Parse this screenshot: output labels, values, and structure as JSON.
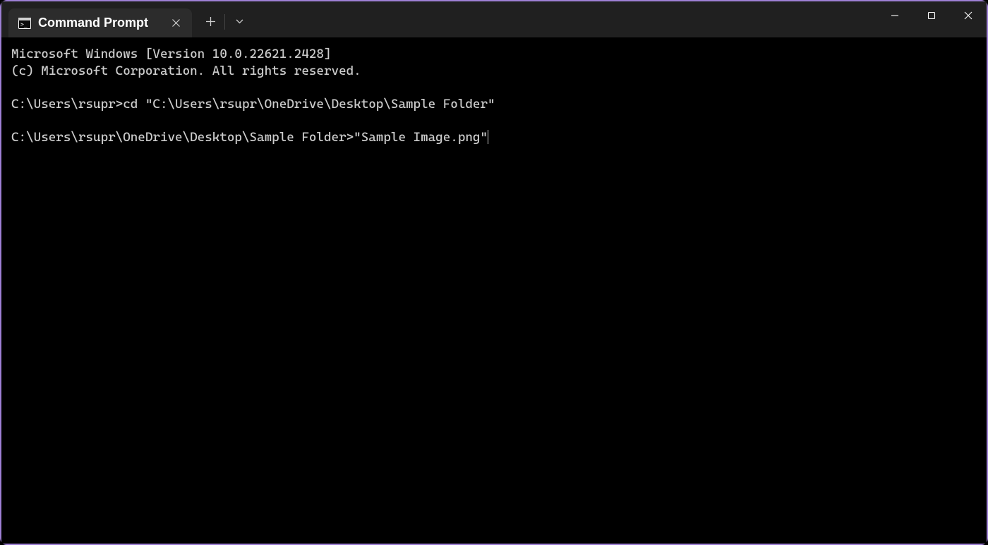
{
  "tab": {
    "title": "Command Prompt"
  },
  "terminal": {
    "line1": "Microsoft Windows [Version 10.0.22621.2428]",
    "line2": "(c) Microsoft Corporation. All rights reserved.",
    "blank1": "",
    "prompt1": "C:\\Users\\rsupr>",
    "command1": "cd \"C:\\Users\\rsupr\\OneDrive\\Desktop\\Sample Folder\"",
    "blank2": "",
    "prompt2": "C:\\Users\\rsupr\\OneDrive\\Desktop\\Sample Folder>",
    "command2": "\"Sample Image.png\""
  }
}
